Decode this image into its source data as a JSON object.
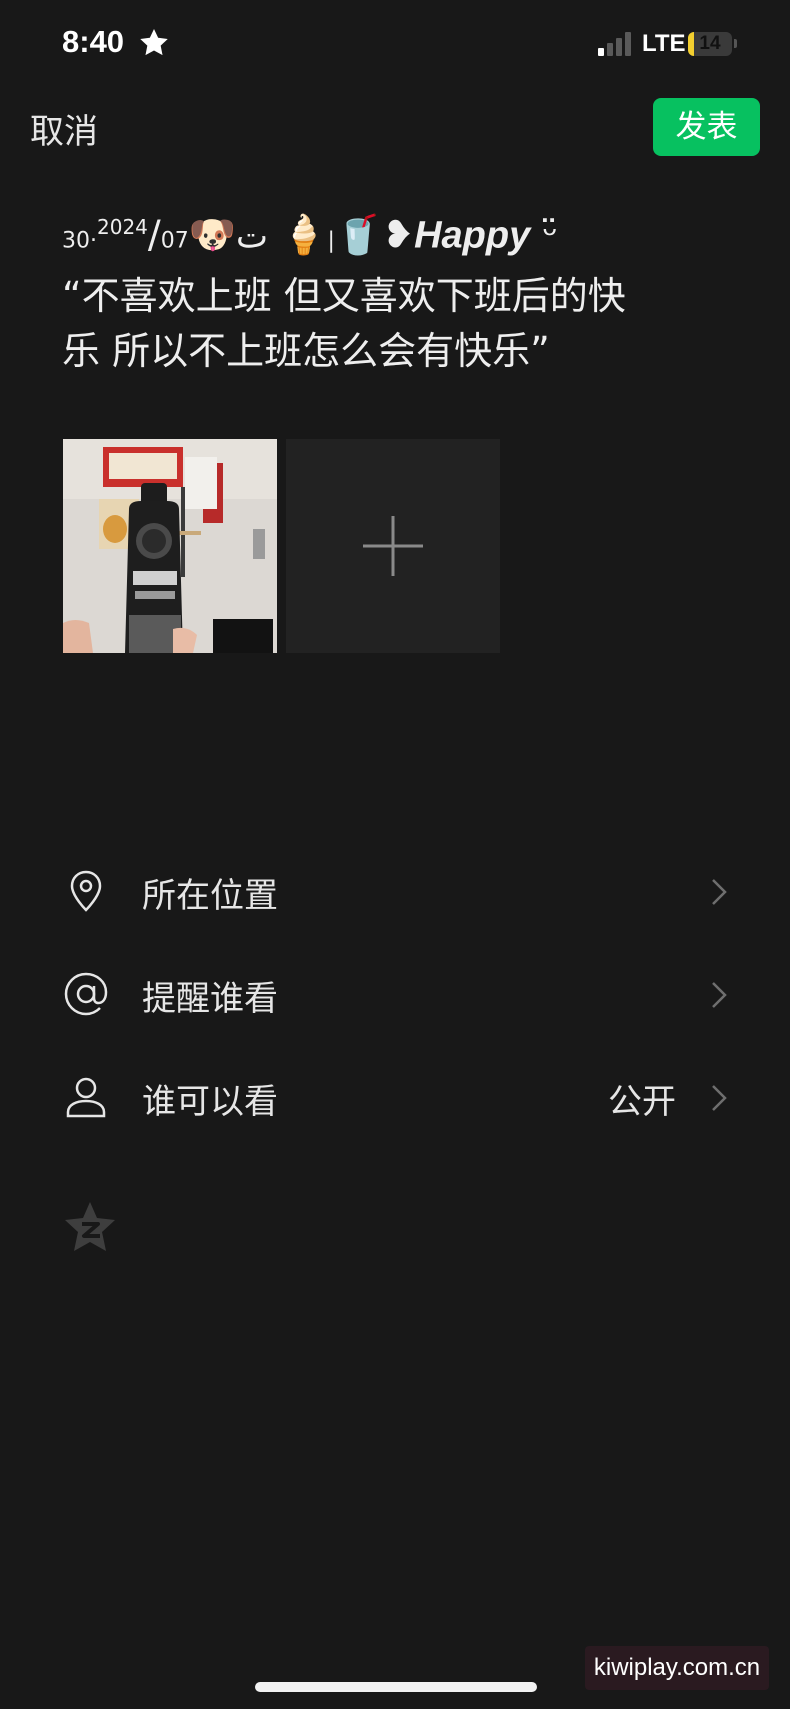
{
  "status_bar": {
    "time": "8:40",
    "network": "LTE",
    "battery": "14",
    "battery_level": 0.14,
    "icons": [
      "star-icon",
      "signal-icon",
      "battery-icon"
    ]
  },
  "header": {
    "cancel_label": "取消",
    "publish_label": "发表",
    "accent": "#07c160"
  },
  "post": {
    "deco_prefix": "ت",
    "emoji_dog": "🐶",
    "year": "2024",
    "slash": "/",
    "date": "07·30",
    "emoji_icecream": "🍦",
    "pipe": "|",
    "emoji_drink": "🥤",
    "heart_deco": "❥",
    "happy": "Happy",
    "smile_deco": "ᵕ̈",
    "line2": "“不喜欢上班 但又喜欢下班后的快",
    "line3": "乐  所以不上班怎么会有快乐”"
  },
  "media": {
    "photo_icon": "coffee-bottle-photo",
    "add_icon": "plus-icon"
  },
  "options": [
    {
      "label": "所在位置",
      "value": "",
      "icon": "location-pin-icon"
    },
    {
      "label": "提醒谁看",
      "value": "",
      "icon": "at-sign-icon"
    },
    {
      "label": "谁可以看",
      "value": "公开",
      "icon": "person-icon"
    }
  ],
  "extras": {
    "qzone_icon": "qzone-star-icon"
  },
  "watermark": "kiwiplay.com.cn"
}
